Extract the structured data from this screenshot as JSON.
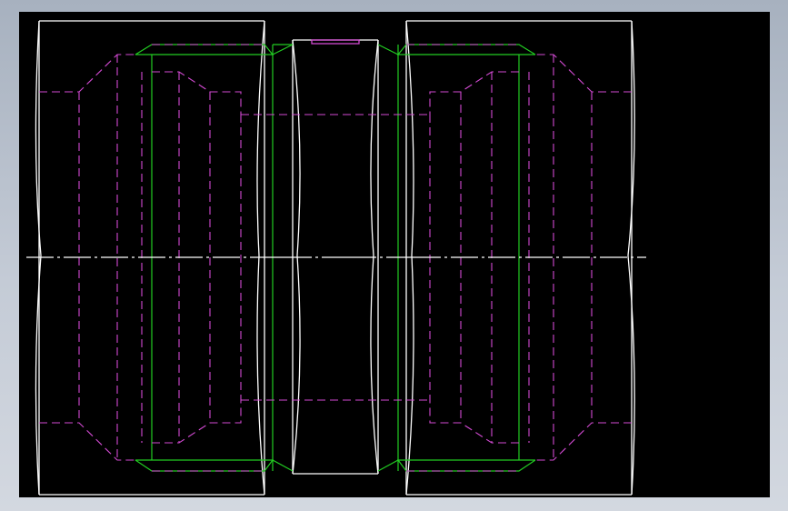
{
  "view": {
    "background_color": "#000000",
    "page_background": "#b8c0cc"
  },
  "colors": {
    "visible_edge": "#ffffff",
    "hidden_edge": "#d24ad2",
    "chamfer_edge": "#22cc22",
    "center_line": "#ffffff"
  },
  "drawing": {
    "type": "cad-section-view",
    "line_styles": [
      "solid-visible",
      "dashed-hidden",
      "solid-tangent",
      "dash-dot-centerline"
    ]
  }
}
